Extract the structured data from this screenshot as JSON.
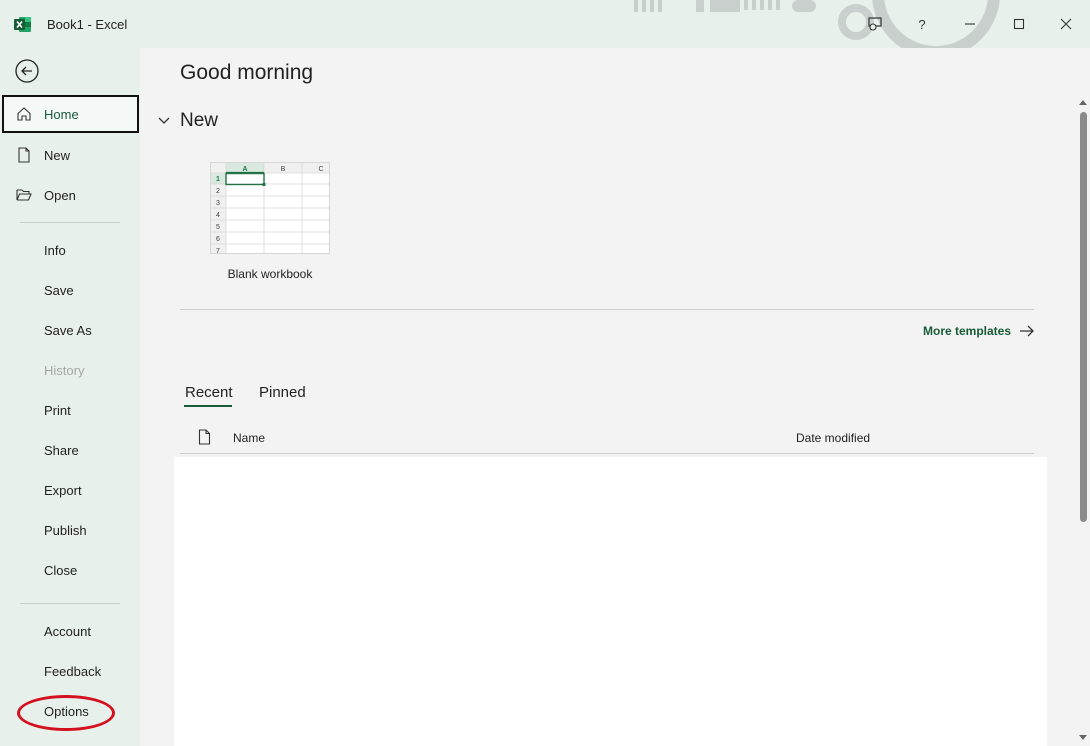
{
  "window": {
    "title": "Book1  -  Excel",
    "accent": "#185c37",
    "highlight": "#d3101e"
  },
  "sidebar": {
    "back_icon": "back-arrow-icon",
    "items": [
      {
        "label": "Home",
        "icon": "home-icon",
        "state": "active"
      },
      {
        "label": "New",
        "icon": "new-document-icon"
      },
      {
        "label": "Open",
        "icon": "folder-open-icon"
      },
      {
        "label": "Info"
      },
      {
        "label": "Save"
      },
      {
        "label": "Save As"
      },
      {
        "label": "History",
        "state": "disabled"
      },
      {
        "label": "Print"
      },
      {
        "label": "Share"
      },
      {
        "label": "Export"
      },
      {
        "label": "Publish"
      },
      {
        "label": "Close"
      },
      {
        "label": "Account"
      },
      {
        "label": "Feedback"
      },
      {
        "label": "Options",
        "annotation": "circled-red"
      }
    ]
  },
  "main": {
    "greeting": "Good morning",
    "new_section": {
      "heading": "New",
      "template_label": "Blank workbook",
      "thumb_columns": [
        "A",
        "B",
        "C"
      ],
      "thumb_rows": [
        "1",
        "2",
        "3",
        "4",
        "5",
        "6",
        "7"
      ]
    },
    "more_templates": "More templates",
    "tabs": [
      {
        "label": "Recent",
        "selected": true
      },
      {
        "label": "Pinned",
        "selected": false
      }
    ],
    "columns": {
      "name": "Name",
      "date": "Date modified"
    }
  }
}
